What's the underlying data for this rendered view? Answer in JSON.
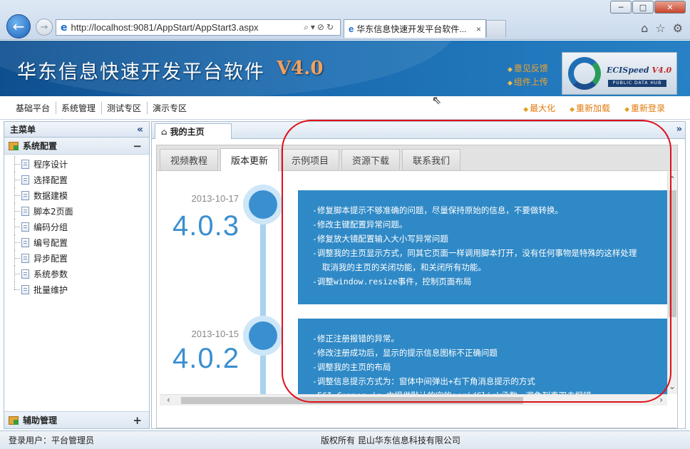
{
  "browser": {
    "url": "http://localhost:9081/AppStart/AppStart3.aspx",
    "tab_title": "华东信息快速开发平台软件...",
    "tab_close": "×",
    "win_min": "─",
    "win_max": "□",
    "win_close": "✕"
  },
  "header": {
    "brand": "华东信息快速开发平台软件",
    "version": "V4.0",
    "links": [
      "意见反馈",
      "组件上传"
    ],
    "logo_text": "ECISpeed",
    "logo_version": "V4.0",
    "logo_sub": "PUBLIC DATA HUB"
  },
  "menubar": {
    "left": [
      "基础平台",
      "系统管理",
      "测试专区",
      "演示专区"
    ],
    "right": [
      "最大化",
      "重新加载",
      "重新登录"
    ]
  },
  "sidebar": {
    "title": "主菜单",
    "collapse_icon": "«",
    "group1": {
      "label": "系统配置",
      "toggle": "−"
    },
    "items": [
      "程序设计",
      "选择配置",
      "数据建模",
      "脚本2页面",
      "编码分组",
      "编号配置",
      "异步配置",
      "系统参数",
      "批量维护"
    ],
    "group2": {
      "label": "辅助管理",
      "toggle": "+"
    }
  },
  "content": {
    "tab_label": "我的主页",
    "more_icon": "»",
    "panel_tabs": [
      "视频教程",
      "版本更新",
      "示例项目",
      "资源下载",
      "联系我们"
    ],
    "active_tab": "版本更新",
    "releases": [
      {
        "date": "2013-10-17",
        "version": "4.0.3",
        "notes": [
          "-修复脚本提示不够准确的问题，尽量保持原始的信息，不要做转换。",
          "-修改主键配置异常问题。",
          "-修复放大镜配置输入大小写异常问题",
          "-调整我的主页显示方式，同其它页面一样调用脚本打开，没有任何事物是特殊的这样处理",
          "  取消我的主页的关闭功能，和关闭所有功能。",
          "-调整window.resize事件，控制页面布局"
        ]
      },
      {
        "date": "2013-10-15",
        "version": "4.0.2",
        "notes": [
          "-修正注册报错的异常。",
          "-修改注册成功后，显示的提示信息图标不正确问题",
          "-调整我的主页的布局",
          "-调整信息提示方式为：窗体中间弹出+右下角消息提示的方式",
          "-ECI.Common.js 中提供默认的空的egridClick函数，避免列表双击报错"
        ]
      }
    ]
  },
  "status": {
    "user": "登录用户：平台管理员",
    "copyright": "版权所有 昆山华东信息科技有限公司"
  },
  "colors": {
    "banner": "#1a6bb0",
    "accent_orange": "#e07a0c",
    "timeline_blue": "#2f89c6",
    "annotation_red": "#e0101a"
  }
}
